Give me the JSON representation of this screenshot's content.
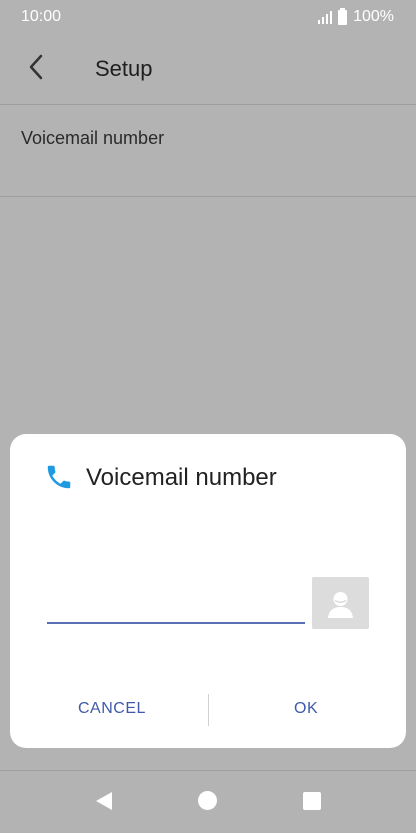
{
  "status_bar": {
    "time": "10:00",
    "battery": "100%"
  },
  "header": {
    "title": "Setup"
  },
  "settings": {
    "voicemail_label": "Voicemail number"
  },
  "dialog": {
    "title": "Voicemail number",
    "input_value": "",
    "cancel_label": "CANCEL",
    "ok_label": "OK"
  },
  "icons": {
    "back": "back-arrow-icon",
    "phone": "phone-icon",
    "contact": "contact-avatar-icon",
    "nav_back": "nav-back-icon",
    "nav_home": "nav-home-icon",
    "nav_recent": "nav-recent-icon"
  },
  "colors": {
    "accent": "#3f5aa8",
    "phone_icon": "#1e9be0",
    "scrim": "#b3b3b3"
  }
}
